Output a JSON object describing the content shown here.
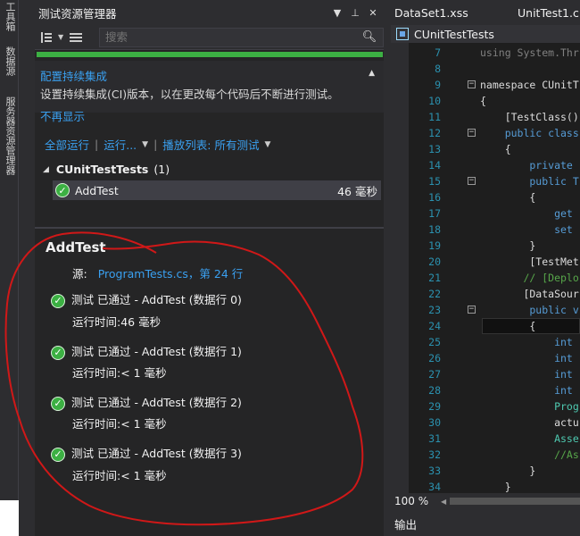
{
  "left_strip": {
    "tabs": [
      "工具箱",
      "数据源",
      "服务器资源管理器"
    ]
  },
  "panel": {
    "title": "测试资源管理器",
    "title_icons": [
      "▼",
      "⊥",
      "✕"
    ],
    "search_placeholder": "搜索",
    "progress_color": "#3cb043",
    "ci": {
      "title": "配置持续集成",
      "description": "设置持续集成(CI)版本，以在更改每个代码后不断进行测试。",
      "dismiss": "不再显示"
    },
    "actions": {
      "run_all": "全部运行",
      "run": "运行...",
      "playlist": "播放列表: 所有测试"
    },
    "group": {
      "name": "CUnitTestTests",
      "count": "(1)"
    },
    "test": {
      "name": "AddTest",
      "duration": "46 毫秒"
    },
    "detail": {
      "title": "AddTest",
      "source_label": "源:",
      "source_link": "ProgramTests.cs，第 24 行",
      "results": [
        {
          "text": "测试 已通过 - AddTest (数据行 0)",
          "time": "运行时间:46 毫秒"
        },
        {
          "text": "测试 已通过 - AddTest (数据行 1)",
          "time": "运行时间:< 1 毫秒"
        },
        {
          "text": "测试 已通过 - AddTest (数据行 2)",
          "time": "运行时间:< 1 毫秒"
        },
        {
          "text": "测试 已通过 - AddTest (数据行 3)",
          "time": "运行时间:< 1 毫秒"
        }
      ]
    }
  },
  "editor": {
    "tabs": [
      "DataSet1.xss",
      "UnitTest1.c"
    ],
    "nav_class": "CUnitTestTests",
    "zoom": "100 %",
    "output_tab": "输出",
    "lines": [
      {
        "n": "7",
        "code": "using System.Thr",
        "color": "#808080",
        "fold": ""
      },
      {
        "n": "8",
        "code": "",
        "color": "#dcdcdc",
        "fold": ""
      },
      {
        "n": "9",
        "code": "namespace CUnitT",
        "color": "#dcdcdc",
        "fold": "−"
      },
      {
        "n": "10",
        "code": "{",
        "color": "#dcdcdc",
        "fold": ""
      },
      {
        "n": "11",
        "code": "    [TestClass()",
        "color": "#dcdcdc",
        "fold": ""
      },
      {
        "n": "12",
        "code": "    public class",
        "color": "#569cd6",
        "fold": "−"
      },
      {
        "n": "13",
        "code": "    {",
        "color": "#dcdcdc",
        "fold": ""
      },
      {
        "n": "14",
        "code": "        private",
        "color": "#569cd6",
        "fold": ""
      },
      {
        "n": "15",
        "code": "        public T",
        "color": "#569cd6",
        "fold": "−"
      },
      {
        "n": "16",
        "code": "        {",
        "color": "#dcdcdc",
        "fold": ""
      },
      {
        "n": "17",
        "code": "            get",
        "color": "#569cd6",
        "fold": ""
      },
      {
        "n": "18",
        "code": "            set",
        "color": "#569cd6",
        "fold": ""
      },
      {
        "n": "19",
        "code": "        }",
        "color": "#dcdcdc",
        "fold": ""
      },
      {
        "n": "20",
        "code": "        [TestMet",
        "color": "#dcdcdc",
        "fold": ""
      },
      {
        "n": "21",
        "code": "       // [Deplo",
        "color": "#57a64a",
        "fold": ""
      },
      {
        "n": "22",
        "code": "       [DataSour",
        "color": "#dcdcdc",
        "fold": ""
      },
      {
        "n": "23",
        "code": "        public v",
        "color": "#569cd6",
        "fold": "−"
      },
      {
        "n": "24",
        "code": "        {",
        "color": "#dcdcdc",
        "fold": ""
      },
      {
        "n": "25",
        "code": "            int",
        "color": "#569cd6",
        "fold": ""
      },
      {
        "n": "26",
        "code": "            int",
        "color": "#569cd6",
        "fold": ""
      },
      {
        "n": "27",
        "code": "            int",
        "color": "#569cd6",
        "fold": ""
      },
      {
        "n": "28",
        "code": "            int",
        "color": "#569cd6",
        "fold": ""
      },
      {
        "n": "29",
        "code": "            Prog",
        "color": "#4ec9b0",
        "fold": ""
      },
      {
        "n": "30",
        "code": "            actu",
        "color": "#dcdcdc",
        "fold": ""
      },
      {
        "n": "31",
        "code": "            Asse",
        "color": "#4ec9b0",
        "fold": ""
      },
      {
        "n": "32",
        "code": "            //As",
        "color": "#57a64a",
        "fold": ""
      },
      {
        "n": "33",
        "code": "        }",
        "color": "#dcdcdc",
        "fold": ""
      },
      {
        "n": "34",
        "code": "    }",
        "color": "#dcdcdc",
        "fold": ""
      }
    ]
  }
}
